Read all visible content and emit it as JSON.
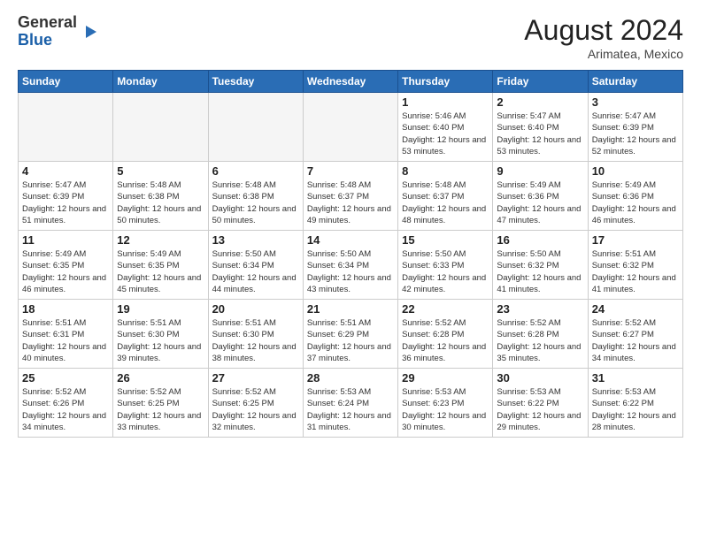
{
  "logo": {
    "general": "General",
    "blue": "Blue"
  },
  "header": {
    "month": "August 2024",
    "location": "Arimatea, Mexico"
  },
  "weekdays": [
    "Sunday",
    "Monday",
    "Tuesday",
    "Wednesday",
    "Thursday",
    "Friday",
    "Saturday"
  ],
  "weeks": [
    [
      {
        "day": "",
        "empty": true
      },
      {
        "day": "",
        "empty": true
      },
      {
        "day": "",
        "empty": true
      },
      {
        "day": "",
        "empty": true
      },
      {
        "day": "1",
        "sunrise": "5:46 AM",
        "sunset": "6:40 PM",
        "daylight": "12 hours and 53 minutes."
      },
      {
        "day": "2",
        "sunrise": "5:47 AM",
        "sunset": "6:40 PM",
        "daylight": "12 hours and 53 minutes."
      },
      {
        "day": "3",
        "sunrise": "5:47 AM",
        "sunset": "6:39 PM",
        "daylight": "12 hours and 52 minutes."
      }
    ],
    [
      {
        "day": "4",
        "sunrise": "5:47 AM",
        "sunset": "6:39 PM",
        "daylight": "12 hours and 51 minutes."
      },
      {
        "day": "5",
        "sunrise": "5:48 AM",
        "sunset": "6:38 PM",
        "daylight": "12 hours and 50 minutes."
      },
      {
        "day": "6",
        "sunrise": "5:48 AM",
        "sunset": "6:38 PM",
        "daylight": "12 hours and 50 minutes."
      },
      {
        "day": "7",
        "sunrise": "5:48 AM",
        "sunset": "6:37 PM",
        "daylight": "12 hours and 49 minutes."
      },
      {
        "day": "8",
        "sunrise": "5:48 AM",
        "sunset": "6:37 PM",
        "daylight": "12 hours and 48 minutes."
      },
      {
        "day": "9",
        "sunrise": "5:49 AM",
        "sunset": "6:36 PM",
        "daylight": "12 hours and 47 minutes."
      },
      {
        "day": "10",
        "sunrise": "5:49 AM",
        "sunset": "6:36 PM",
        "daylight": "12 hours and 46 minutes."
      }
    ],
    [
      {
        "day": "11",
        "sunrise": "5:49 AM",
        "sunset": "6:35 PM",
        "daylight": "12 hours and 46 minutes."
      },
      {
        "day": "12",
        "sunrise": "5:49 AM",
        "sunset": "6:35 PM",
        "daylight": "12 hours and 45 minutes."
      },
      {
        "day": "13",
        "sunrise": "5:50 AM",
        "sunset": "6:34 PM",
        "daylight": "12 hours and 44 minutes."
      },
      {
        "day": "14",
        "sunrise": "5:50 AM",
        "sunset": "6:34 PM",
        "daylight": "12 hours and 43 minutes."
      },
      {
        "day": "15",
        "sunrise": "5:50 AM",
        "sunset": "6:33 PM",
        "daylight": "12 hours and 42 minutes."
      },
      {
        "day": "16",
        "sunrise": "5:50 AM",
        "sunset": "6:32 PM",
        "daylight": "12 hours and 41 minutes."
      },
      {
        "day": "17",
        "sunrise": "5:51 AM",
        "sunset": "6:32 PM",
        "daylight": "12 hours and 41 minutes."
      }
    ],
    [
      {
        "day": "18",
        "sunrise": "5:51 AM",
        "sunset": "6:31 PM",
        "daylight": "12 hours and 40 minutes."
      },
      {
        "day": "19",
        "sunrise": "5:51 AM",
        "sunset": "6:30 PM",
        "daylight": "12 hours and 39 minutes."
      },
      {
        "day": "20",
        "sunrise": "5:51 AM",
        "sunset": "6:30 PM",
        "daylight": "12 hours and 38 minutes."
      },
      {
        "day": "21",
        "sunrise": "5:51 AM",
        "sunset": "6:29 PM",
        "daylight": "12 hours and 37 minutes."
      },
      {
        "day": "22",
        "sunrise": "5:52 AM",
        "sunset": "6:28 PM",
        "daylight": "12 hours and 36 minutes."
      },
      {
        "day": "23",
        "sunrise": "5:52 AM",
        "sunset": "6:28 PM",
        "daylight": "12 hours and 35 minutes."
      },
      {
        "day": "24",
        "sunrise": "5:52 AM",
        "sunset": "6:27 PM",
        "daylight": "12 hours and 34 minutes."
      }
    ],
    [
      {
        "day": "25",
        "sunrise": "5:52 AM",
        "sunset": "6:26 PM",
        "daylight": "12 hours and 34 minutes."
      },
      {
        "day": "26",
        "sunrise": "5:52 AM",
        "sunset": "6:25 PM",
        "daylight": "12 hours and 33 minutes."
      },
      {
        "day": "27",
        "sunrise": "5:52 AM",
        "sunset": "6:25 PM",
        "daylight": "12 hours and 32 minutes."
      },
      {
        "day": "28",
        "sunrise": "5:53 AM",
        "sunset": "6:24 PM",
        "daylight": "12 hours and 31 minutes."
      },
      {
        "day": "29",
        "sunrise": "5:53 AM",
        "sunset": "6:23 PM",
        "daylight": "12 hours and 30 minutes."
      },
      {
        "day": "30",
        "sunrise": "5:53 AM",
        "sunset": "6:22 PM",
        "daylight": "12 hours and 29 minutes."
      },
      {
        "day": "31",
        "sunrise": "5:53 AM",
        "sunset": "6:22 PM",
        "daylight": "12 hours and 28 minutes."
      }
    ]
  ]
}
